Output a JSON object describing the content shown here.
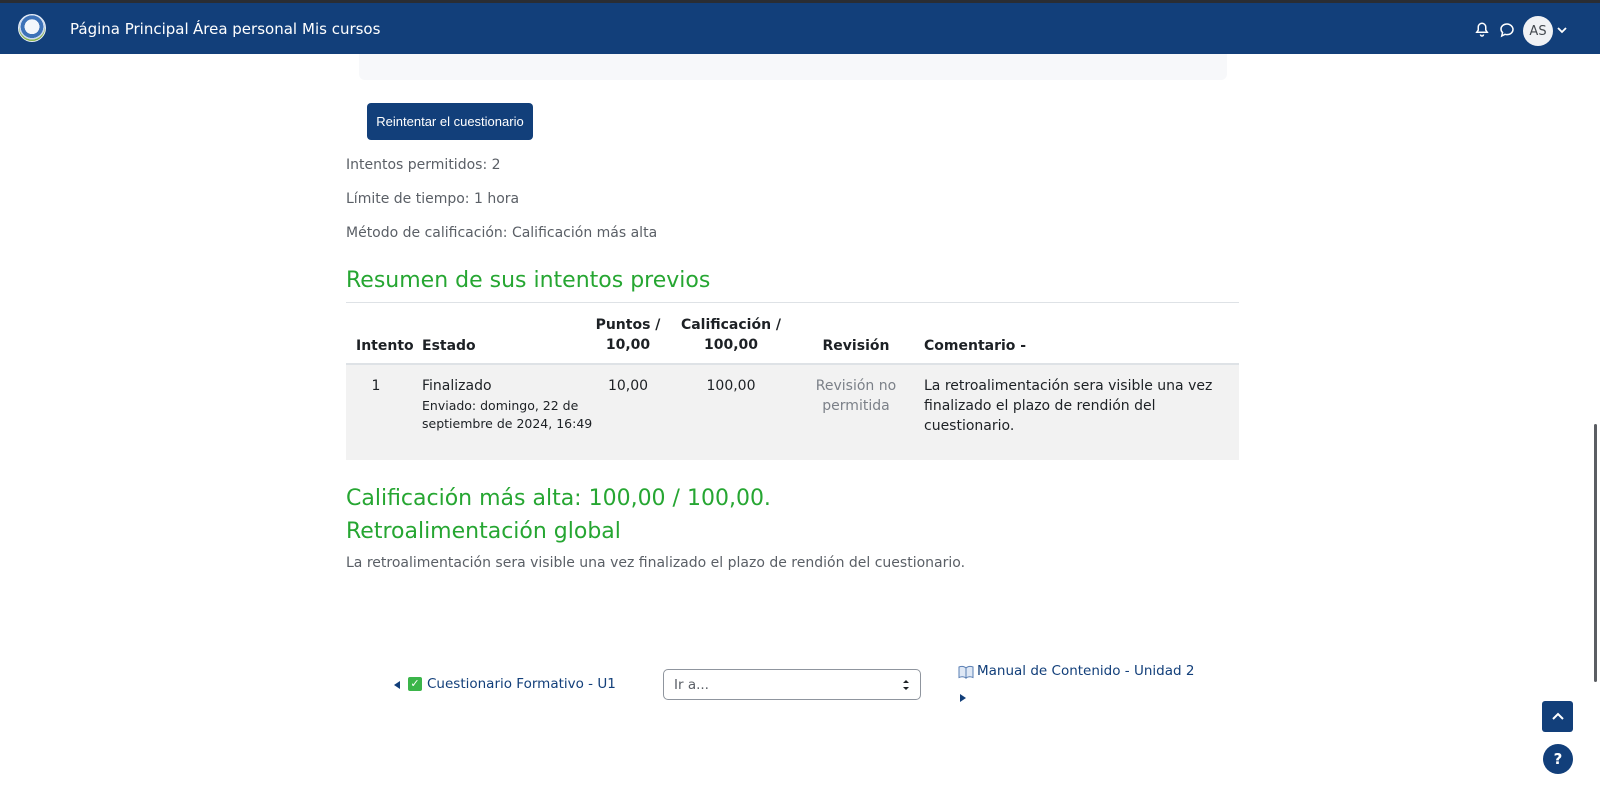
{
  "nav": {
    "items": [
      {
        "label": "Página Principal"
      },
      {
        "label": "Área personal"
      },
      {
        "label": "Mis cursos"
      }
    ],
    "user_initials": "AS",
    "icons": [
      "notification-bell-icon",
      "messages-icon",
      "chevron-down-icon"
    ]
  },
  "quiz": {
    "reattempt_label": "Reintentar el cuestionario",
    "attempts_allowed": "Intentos permitidos: 2",
    "time_limit": "Límite de tiempo: 1 hora",
    "grading_method": "Método de calificación: Calificación más alta"
  },
  "summary": {
    "title": "Resumen de sus intentos previos",
    "columns": {
      "attempt": "Intento",
      "state": "Estado",
      "points_line1": "Puntos /",
      "points_line2": "10,00",
      "grade_line1": "Calificación /",
      "grade_line2": "100,00",
      "review": "Revisión",
      "comment": "Comentario -"
    },
    "rows": [
      {
        "attempt": "1",
        "state": "Finalizado",
        "submitted_line1": "Enviado: domingo, 22 de",
        "submitted_line2": "septiembre de 2024, 16:49",
        "points": "10,00",
        "grade": "100,00",
        "review_line1": "Revisión no",
        "review_line2": "permitida",
        "comment_line1": "La retroalimentación sera visible una vez",
        "comment_line2": "finalizado el plazo de rendión del",
        "comment_line3": "cuestionario."
      }
    ]
  },
  "highest_grade": "Calificación más alta: 100,00 / 100,00.",
  "feedback": {
    "title": "Retroalimentación global",
    "text": "La retroalimentación sera visible una vez finalizado el plazo de rendión del cuestionario."
  },
  "activity_nav": {
    "prev_label": "Cuestionario Formativo - U1",
    "jump_placeholder": "Ir a...",
    "next_label": "Manual de Contenido - Unidad 2"
  },
  "help_label": "?",
  "colors": {
    "brand": "#123f7a",
    "heading_green": "#26a632",
    "row_bg": "#f2f2f2"
  }
}
